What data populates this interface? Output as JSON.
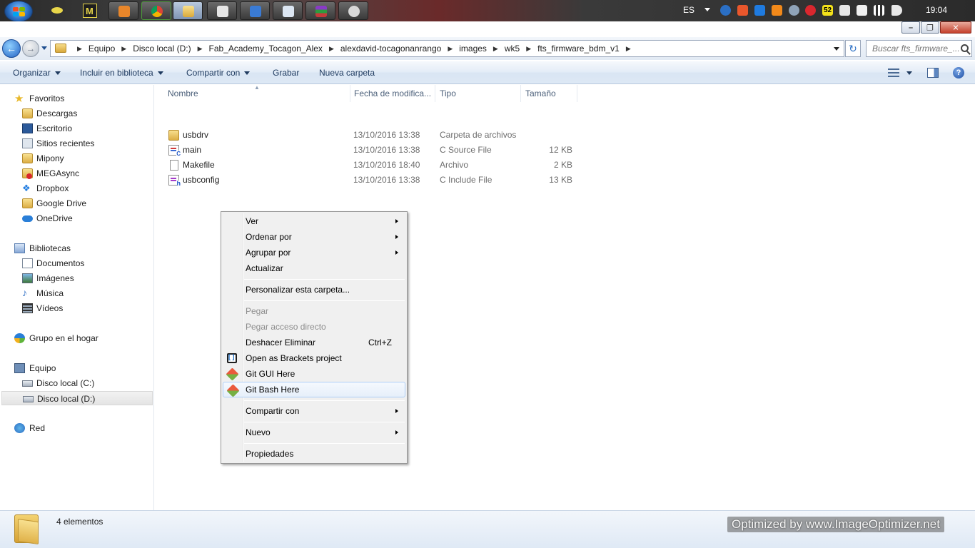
{
  "taskbar": {
    "language": "ES",
    "clock": "19:04",
    "tray_badge": "52"
  },
  "window": {
    "nav": {
      "breadcrumb": [
        "Equipo",
        "Disco local (D:)",
        "Fab_Academy_Tocagon_Alex",
        "alexdavid-tocagonanrango",
        "images",
        "wk5",
        "fts_firmware_bdm_v1"
      ],
      "search_placeholder": "Buscar fts_firmware_..."
    },
    "command_bar": {
      "organize": "Organizar",
      "include_in_library": "Incluir en biblioteca",
      "share_with": "Compartir con",
      "burn": "Grabar",
      "new_folder": "Nueva carpeta"
    },
    "sidebar": {
      "favorites": {
        "title": "Favoritos",
        "items": [
          "Descargas",
          "Escritorio",
          "Sitios recientes",
          "Mipony",
          "MEGAsync",
          "Dropbox",
          "Google Drive",
          "OneDrive"
        ]
      },
      "libraries": {
        "title": "Bibliotecas",
        "items": [
          "Documentos",
          "Imágenes",
          "Música",
          "Vídeos"
        ]
      },
      "homegroup": "Grupo en el hogar",
      "computer": {
        "title": "Equipo",
        "items": [
          "Disco local (C:)",
          "Disco local (D:)"
        ],
        "selected": "Disco local (D:)"
      },
      "network": "Red"
    },
    "columns": {
      "name": "Nombre",
      "date": "Fecha de modifica...",
      "type": "Tipo",
      "size": "Tamaño"
    },
    "files": [
      {
        "name": "usbdrv",
        "date": "13/10/2016 13:38",
        "type": "Carpeta de archivos",
        "size": "",
        "icon": "folder-icon"
      },
      {
        "name": "main",
        "date": "13/10/2016 13:38",
        "type": "C Source File",
        "size": "12 KB",
        "icon": "c-source-file-icon"
      },
      {
        "name": "Makefile",
        "date": "13/10/2016 18:40",
        "type": "Archivo",
        "size": "2 KB",
        "icon": "blank-file-icon"
      },
      {
        "name": "usbconfig",
        "date": "13/10/2016 13:38",
        "type": "C Include File",
        "size": "13 KB",
        "icon": "c-header-file-icon"
      }
    ],
    "status": {
      "item_count": "4 elementos"
    }
  },
  "context_menu": {
    "items": [
      {
        "label": "Ver",
        "submenu": true
      },
      {
        "label": "Ordenar por",
        "submenu": true
      },
      {
        "label": "Agrupar por",
        "submenu": true
      },
      {
        "label": "Actualizar"
      },
      {
        "label": "Personalizar esta carpeta..."
      },
      {
        "label": "Pegar",
        "disabled": true
      },
      {
        "label": "Pegar acceso directo",
        "disabled": true
      },
      {
        "label": "Deshacer Eliminar",
        "shortcut": "Ctrl+Z"
      },
      {
        "label": "Open as Brackets project",
        "icon": "brackets-icon"
      },
      {
        "label": "Git GUI Here",
        "icon": "git-icon"
      },
      {
        "label": "Git Bash Here",
        "icon": "git-icon",
        "hover": true
      },
      {
        "label": "Compartir con",
        "submenu": true
      },
      {
        "label": "Nuevo",
        "submenu": true
      },
      {
        "label": "Propiedades"
      }
    ]
  },
  "watermark": "Optimized by www.ImageOptimizer.net"
}
